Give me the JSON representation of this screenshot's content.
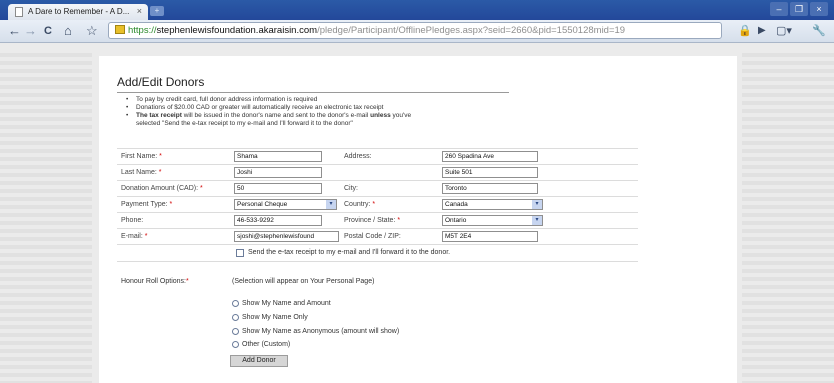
{
  "browser": {
    "tab_title": "A Dare to Remember - A D...",
    "tab_close": "×",
    "url_scheme": "https://",
    "url_host": "stephenlewisfoundation.akaraisin.com",
    "url_path": "/pledge/Participant/OfflinePledges.aspx?seid=2660&pid=1550128mid=19",
    "nav_back": "←",
    "nav_forward": "→",
    "nav_reload": "C",
    "nav_home": "⌂",
    "nav_star": "☆",
    "win_min": "–",
    "win_max": "❐",
    "win_close": "×"
  },
  "page": {
    "heading": "Add/Edit Donors",
    "notes": [
      "To pay by credit card, full donor address information is required",
      "Donations of $20.00 CAD or greater will automatically receive an electronic tax receipt"
    ],
    "note3_bold": "The tax receipt",
    "note3_a": " will be issued in the donor's name and sent to the donor's e-mail ",
    "note3_bold2": "unless",
    "note3_b": " you've",
    "note3_line2": "selected \"Send the e-tax receipt to my e-mail and I'll forward it to the donor\""
  },
  "form": {
    "first_name": {
      "label": "First Name:",
      "value": "Shama"
    },
    "last_name": {
      "label": "Last Name:",
      "value": "Joshi"
    },
    "donation_amount": {
      "label": "Donation Amount (CAD):",
      "value": "50"
    },
    "payment_type": {
      "label": "Payment Type:",
      "value": "Personal Cheque"
    },
    "phone": {
      "label": "Phone:",
      "value": "46-533-9292"
    },
    "email": {
      "label": "E-mail:",
      "value": "sjoshi@stephenlewisfound"
    },
    "address": {
      "label": "Address:",
      "value1": "260 Spadina Ave",
      "value2": "Suite 501"
    },
    "city": {
      "label": "City:",
      "value": "Toronto"
    },
    "country": {
      "label": "Country:",
      "value": "Canada"
    },
    "province": {
      "label": "Province / State:",
      "value": "Ontario"
    },
    "postal": {
      "label": "Postal Code / ZIP:",
      "value": "M5T 2E4"
    },
    "required_mark": "*",
    "etax_label": "Send the e-tax receipt to my e-mail and I'll forward it to the donor.",
    "honour_label": "Honour Roll Options:",
    "honour_note": "(Selection will appear on Your Personal Page)",
    "honour_options": [
      "Show My Name and Amount",
      "Show My Name Only",
      "Show My Name as Anonymous (amount will show)",
      "Other (Custom)"
    ],
    "submit_label": "Add Donor",
    "dropdown_arrow": "▾"
  }
}
